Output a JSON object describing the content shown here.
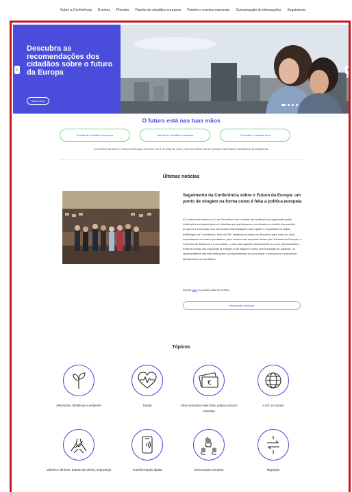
{
  "nav": {
    "items": [
      "Sobre a Conferência",
      "Eventos",
      "Plenário",
      "Painéis de cidadãos europeus",
      "Painéis e eventos nacionais",
      "Comunicação de informações",
      "Seguimento"
    ]
  },
  "hero": {
    "title": "Descubra as recomendações dos cidadãos sobre o futuro da Europa",
    "button": "Saiba mais",
    "prev_icon": "chevron-left-icon",
    "next_icon": "chevron-right-icon",
    "slide_count": 4,
    "active_slide": 1
  },
  "future": {
    "title": "O futuro está nas tuas mãos",
    "buttons": [
      "Painéis de cidadãos europeus",
      "Painéis de cidadãos nacionais",
      "Consultar o relatório final"
    ],
    "note": "A Conferência sobre o Futuro da Europa terminou em 9 de maio de 2022, pelo que deixou de ser possível apresentar contributos na plataforma."
  },
  "news": {
    "section_title": "Últimas notícias",
    "headline": "Seguimento da Conferência sobre o Futuro da Europa: um ponto de viragem na forma como é feita a política europeia",
    "body": "A Conferência terminou a 2 de Dezembro com o evento de feedback-up organizado pelas instituições europeias para os cidadãos que participaram nos debates no âmbito dos painéis europeus e nacionais, nas numerosas manifestações nas regiões e na plataforma digital multilíngue da Conferência. Mais de 500 cidadãos reunidos em Bruxelas para uma vez mais expressarem as suas expectativas, para ouvirem as respostas dadas pelo Parlamento Europeu, o Conselho de Ministros e a Comissão, e para interrogarem directamente os seus representantes. Embora muitas das propostas já estejam a ser tidas em conta na formulação de políticas, os representantes das três instituições comprometeram-se a continuar o exercício e a comunicar abertamente os resultados.",
    "more_prefix": "Reviva ",
    "more_link": "aqui",
    "more_suffix": " os pontos altos do evento.",
    "button": "Informação adicional"
  },
  "topics": {
    "title": "Tópicos",
    "items": [
      {
        "label": "Alterações climáticas e ambiente",
        "icon": "sprout-icon"
      },
      {
        "label": "Saúde",
        "icon": "heart-pulse-icon"
      },
      {
        "label": "Uma economia mais forte, justiça social e emprego",
        "icon": "euro-banknote-icon"
      },
      {
        "label": "A UE no mundo",
        "icon": "globe-icon"
      },
      {
        "label": "Valores e direitos, Estado de direito, segurança",
        "icon": "joined-hands-icon"
      },
      {
        "label": "Transformação digital",
        "icon": "smartphone-icon"
      },
      {
        "label": "Democracia europeia",
        "icon": "raised-hands-icon"
      },
      {
        "label": "Migração",
        "icon": "migration-arrows-icon"
      }
    ]
  },
  "colors": {
    "accent": "#4a4ddb",
    "button_border": "#7ed07e",
    "frame": "#c4161c"
  }
}
